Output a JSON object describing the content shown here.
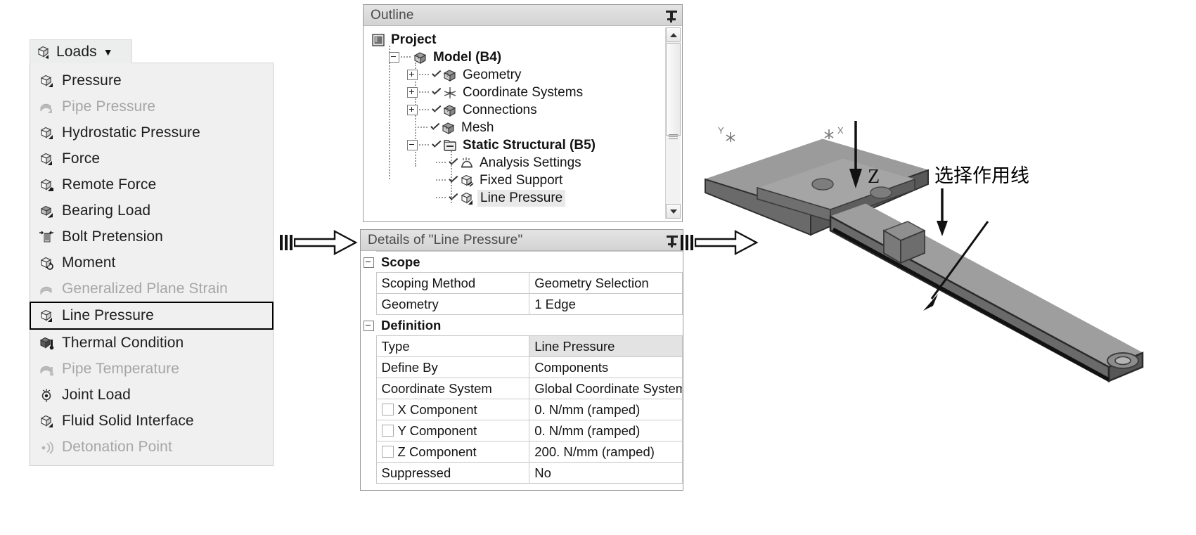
{
  "loads_menu": {
    "button_label": "Loads",
    "button_icon": "load-cube-icon",
    "caret_icon": "caret-down-icon",
    "items": [
      {
        "label": "Pressure",
        "icon": "pressure-cube-icon",
        "enabled": true,
        "selected": false
      },
      {
        "label": "Pipe Pressure",
        "icon": "pipe-pressure-icon",
        "enabled": false,
        "selected": false
      },
      {
        "label": "Hydrostatic Pressure",
        "icon": "hydrostatic-pressure-icon",
        "enabled": true,
        "selected": false
      },
      {
        "label": "Force",
        "icon": "force-cube-icon",
        "enabled": true,
        "selected": false
      },
      {
        "label": "Remote Force",
        "icon": "remote-force-icon",
        "enabled": true,
        "selected": false
      },
      {
        "label": "Bearing Load",
        "icon": "bearing-load-icon",
        "enabled": true,
        "selected": false
      },
      {
        "label": "Bolt Pretension",
        "icon": "bolt-pretension-icon",
        "enabled": true,
        "selected": false
      },
      {
        "label": "Moment",
        "icon": "moment-icon",
        "enabled": true,
        "selected": false
      },
      {
        "label": "Generalized Plane Strain",
        "icon": "plane-strain-icon",
        "enabled": false,
        "selected": false
      },
      {
        "label": "Line Pressure",
        "icon": "line-pressure-icon",
        "enabled": true,
        "selected": true
      },
      {
        "label": "Thermal Condition",
        "icon": "thermal-condition-icon",
        "enabled": true,
        "selected": false
      },
      {
        "label": "Pipe Temperature",
        "icon": "pipe-temperature-icon",
        "enabled": false,
        "selected": false
      },
      {
        "label": "Joint Load",
        "icon": "joint-load-icon",
        "enabled": true,
        "selected": false
      },
      {
        "label": "Fluid Solid Interface",
        "icon": "fluid-solid-interface-icon",
        "enabled": true,
        "selected": false
      },
      {
        "label": "Detonation Point",
        "icon": "detonation-point-icon",
        "enabled": false,
        "selected": false
      }
    ]
  },
  "outline": {
    "title": "Outline",
    "pin_icon": "pin-icon",
    "scrollbar": {
      "up_icon": "scroll-up-arrow-icon",
      "down_icon": "scroll-down-arrow-icon"
    },
    "tree": [
      {
        "label": "Project",
        "icon": "project-icon",
        "bold": true,
        "depth": 0,
        "expander": "",
        "check": false,
        "highlight": false
      },
      {
        "label": "Model (B4)",
        "icon": "model-icon",
        "bold": true,
        "depth": 1,
        "expander": "minus",
        "check": false,
        "highlight": false
      },
      {
        "label": "Geometry",
        "icon": "geometry-icon",
        "bold": false,
        "depth": 2,
        "expander": "plus",
        "check": true,
        "highlight": false
      },
      {
        "label": "Coordinate Systems",
        "icon": "coordinate-systems-icon",
        "bold": false,
        "depth": 2,
        "expander": "plus",
        "check": true,
        "highlight": false
      },
      {
        "label": "Connections",
        "icon": "connections-icon",
        "bold": false,
        "depth": 2,
        "expander": "plus",
        "check": true,
        "highlight": false
      },
      {
        "label": "Mesh",
        "icon": "mesh-icon",
        "bold": false,
        "depth": 2,
        "expander": "",
        "check": true,
        "highlight": false
      },
      {
        "label": "Static Structural (B5)",
        "icon": "static-structural-icon",
        "bold": true,
        "depth": 2,
        "expander": "minus",
        "check": true,
        "highlight": false
      },
      {
        "label": "Analysis Settings",
        "icon": "analysis-settings-icon",
        "bold": false,
        "depth": 3,
        "expander": "",
        "check": true,
        "highlight": false
      },
      {
        "label": "Fixed Support",
        "icon": "fixed-support-icon",
        "bold": false,
        "depth": 3,
        "expander": "",
        "check": true,
        "highlight": false
      },
      {
        "label": "Line Pressure",
        "icon": "line-pressure-icon",
        "bold": false,
        "depth": 3,
        "expander": "",
        "check": true,
        "highlight": true
      }
    ]
  },
  "details": {
    "title": "Details of \"Line Pressure\"",
    "pin_icon": "pin-icon",
    "rows": [
      {
        "kind": "group",
        "label": "Scope"
      },
      {
        "kind": "row",
        "key": "Scoping Method",
        "value": "Geometry Selection",
        "checkbox": false,
        "shaded": false
      },
      {
        "kind": "row",
        "key": "Geometry",
        "value": "1 Edge",
        "checkbox": false,
        "shaded": false
      },
      {
        "kind": "group",
        "label": "Definition"
      },
      {
        "kind": "row",
        "key": "Type",
        "value": "Line Pressure",
        "checkbox": false,
        "shaded": true
      },
      {
        "kind": "row",
        "key": "Define By",
        "value": "Components",
        "checkbox": false,
        "shaded": false
      },
      {
        "kind": "row",
        "key": "Coordinate System",
        "value": "Global Coordinate System",
        "checkbox": false,
        "shaded": false
      },
      {
        "kind": "row",
        "key": "X Component",
        "value": "0. N/mm  (ramped)",
        "checkbox": true,
        "shaded": false
      },
      {
        "kind": "row",
        "key": "Y Component",
        "value": "0. N/mm  (ramped)",
        "checkbox": true,
        "shaded": false
      },
      {
        "kind": "row",
        "key": "Z Component",
        "value": "200. N/mm  (ramped)",
        "checkbox": true,
        "shaded": false
      },
      {
        "kind": "row",
        "key": "Suppressed",
        "value": "No",
        "checkbox": false,
        "shaded": false
      }
    ]
  },
  "connectors": [
    {
      "name": "arrow-menu-to-details",
      "icon": "block-arrow-right-icon"
    },
    {
      "name": "arrow-details-to-viewport",
      "icon": "block-arrow-right-icon"
    }
  ],
  "viewport": {
    "axis_z_label": "Z",
    "axis_x_label": "X",
    "axis_y_label": "Y",
    "annotation": "选择作用线",
    "annotation_arrow": "callout-arrow-icon",
    "colors": {
      "body_top": "#9b9b9b",
      "body_side": "#6f6f6f",
      "body_edge": "#3a3a3a",
      "selected_edge": "#1a1a1a",
      "marker": "#8a8a8a"
    }
  }
}
